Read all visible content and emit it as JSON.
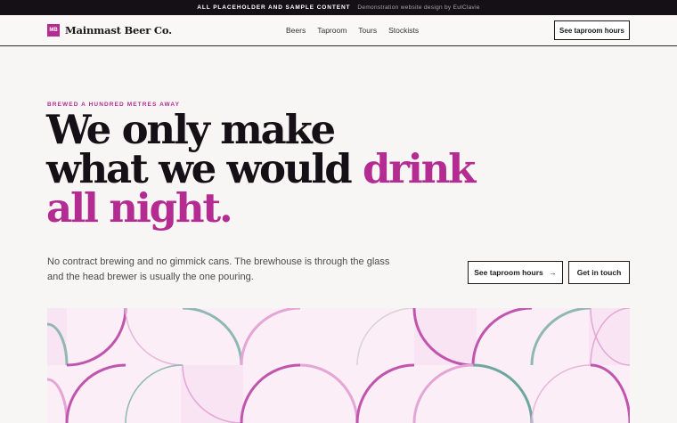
{
  "topbar": {
    "notice": "ALL PLACEHOLDER AND SAMPLE CONTENT",
    "credit": "Demonstration website design by EulClavie"
  },
  "nav": {
    "logo_badge": "MB",
    "brand": "Mainmast Beer Co.",
    "links": [
      "Beers",
      "Taproom",
      "Tours",
      "Stockists"
    ],
    "cta": "See taproom hours"
  },
  "hero": {
    "eyebrow": "BREWED A HUNDRED METRES AWAY",
    "headline_line1": "We only make",
    "headline_line2a": "what we would ",
    "headline_line2b": "drink",
    "headline_line3": "all night.",
    "lede": "No contract brewing and no gimmick cans. The brewhouse is through the glass and the head brewer is usually the one pouring.",
    "primary_button": "See taproom hours",
    "primary_arrow": "→",
    "secondary_button": "Get in touch"
  },
  "colors": {
    "accent": "#b42c91",
    "teal": "#6ea7a0",
    "pink": "#c860b4",
    "light_pink": "#e3a6d5",
    "pattern_bg": "#fbeef6",
    "topbar_bg": "#141015"
  },
  "icons": {
    "arrow": "arrow-right-icon"
  }
}
